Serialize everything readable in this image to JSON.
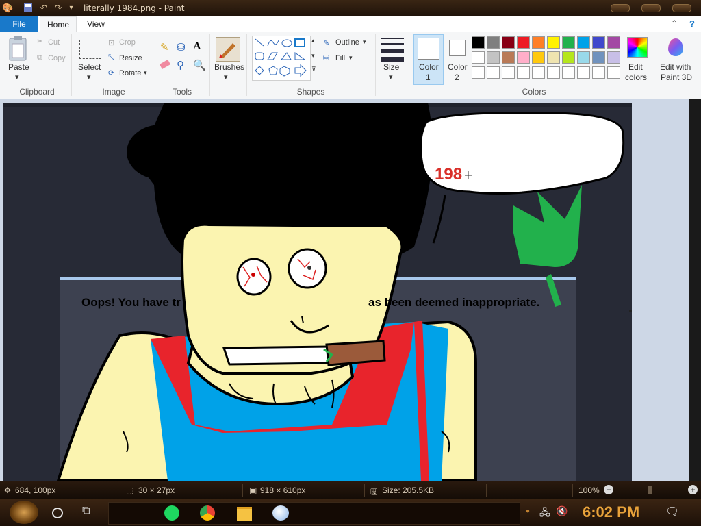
{
  "window": {
    "title": "literally 1984.png - Paint"
  },
  "menu": {
    "tabs": [
      "File",
      "Home",
      "View"
    ]
  },
  "ribbon": {
    "clipboard": {
      "paste": "Paste",
      "cut": "Cut",
      "copy": "Copy",
      "group": "Clipboard"
    },
    "image": {
      "select": "Select",
      "crop": "Crop",
      "resize": "Resize",
      "rotate": "Rotate",
      "group": "Image"
    },
    "tools": {
      "group": "Tools"
    },
    "brushes": {
      "label": "Brushes"
    },
    "shapes": {
      "outline": "Outline",
      "fill": "Fill",
      "group": "Shapes"
    },
    "size": {
      "label": "Size"
    },
    "color1": {
      "line1": "Color",
      "line2": "1"
    },
    "color2": {
      "line1": "Color",
      "line2": "2"
    },
    "colors": {
      "group": "Colors",
      "edit_line1": "Edit",
      "edit_line2": "colors"
    },
    "paint3d": {
      "line1": "Edit with",
      "line2": "Paint 3D"
    },
    "palette_row1": [
      "#000000",
      "#7f7f7f",
      "#880015",
      "#ed1c24",
      "#ff7f27",
      "#fff200",
      "#22b14c",
      "#00a2e8",
      "#3f48cc",
      "#a349a4"
    ],
    "palette_row2": [
      "#ffffff",
      "#c3c3c3",
      "#b97a57",
      "#ffaec9",
      "#ffc90e",
      "#efe4b0",
      "#b5e61d",
      "#99d9ea",
      "#7092be",
      "#c8bfe7"
    ]
  },
  "canvas": {
    "speech_text": "198",
    "dialog_left": "Oops! You have tr",
    "dialog_right": "as been deemed inappropriate."
  },
  "statusbar": {
    "cursor": "684, 100px",
    "selection": "30 × 27px",
    "image_size": "918 × 610px",
    "file_size": "Size: 205.5KB",
    "zoom": "100%"
  },
  "taskbar": {
    "clock": "6:02 PM"
  }
}
